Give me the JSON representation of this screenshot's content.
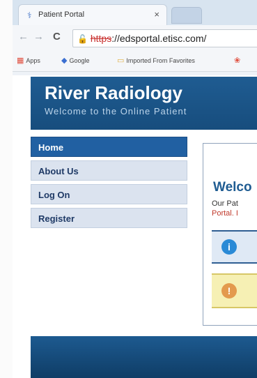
{
  "browser": {
    "tab_title": "Patient Portal",
    "tab_close": "×",
    "nav": {
      "back": "←",
      "forward": "→",
      "reload": "C"
    },
    "url_scheme": "https",
    "url_rest": "://edsportal.etisc.com/",
    "bookmarks": [
      "Apps",
      "Google",
      "Imported From Favorites"
    ]
  },
  "site": {
    "title": "River Radiology",
    "subtitle": "Welcome to the Online Patient"
  },
  "menu": {
    "items": [
      {
        "label": "Home",
        "active": true
      },
      {
        "label": "About Us"
      },
      {
        "label": "Log On"
      },
      {
        "label": "Register"
      }
    ]
  },
  "panel": {
    "heading": "Welco",
    "text_line1": "Our Pat",
    "text_line2": "Portal. I"
  },
  "icons": {
    "info": "i",
    "warning": "!"
  },
  "colors": {
    "header_blue": "#1f5c92",
    "menu_active": "#2160a2",
    "menu_inactive": "#dbe3ef",
    "warning_bg": "#f6f0b4",
    "info_bg": "#dfe9f5"
  }
}
